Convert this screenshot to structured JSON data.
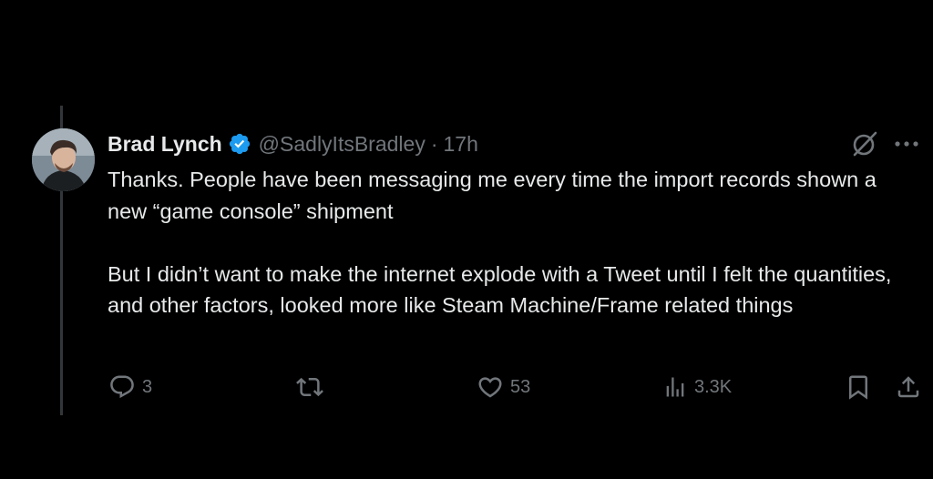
{
  "tweet": {
    "author": {
      "display_name": "Brad Lynch",
      "handle": "@SadlyItsBradley",
      "verified": true
    },
    "separator": "·",
    "time": "17h",
    "paragraphs": [
      "Thanks. People have been messaging me every time the import records shown a new “game console” shipment",
      "But I didn’t want to make the internet explode with a Tweet until I felt the quantities, and other factors, looked more like Steam Machine/Frame related things"
    ],
    "actions": {
      "replies": "3",
      "retweets": "",
      "likes": "53",
      "views": "3.3K"
    }
  },
  "colors": {
    "background": "#000000",
    "text": "#e7e9ea",
    "muted": "#71767b",
    "verified_blue": "#1d9bf0",
    "thread_line": "#333639"
  },
  "icons": [
    "verified-badge-icon",
    "grok-icon",
    "more-icon",
    "reply-icon",
    "retweet-icon",
    "like-icon",
    "views-icon",
    "bookmark-icon",
    "share-icon"
  ]
}
